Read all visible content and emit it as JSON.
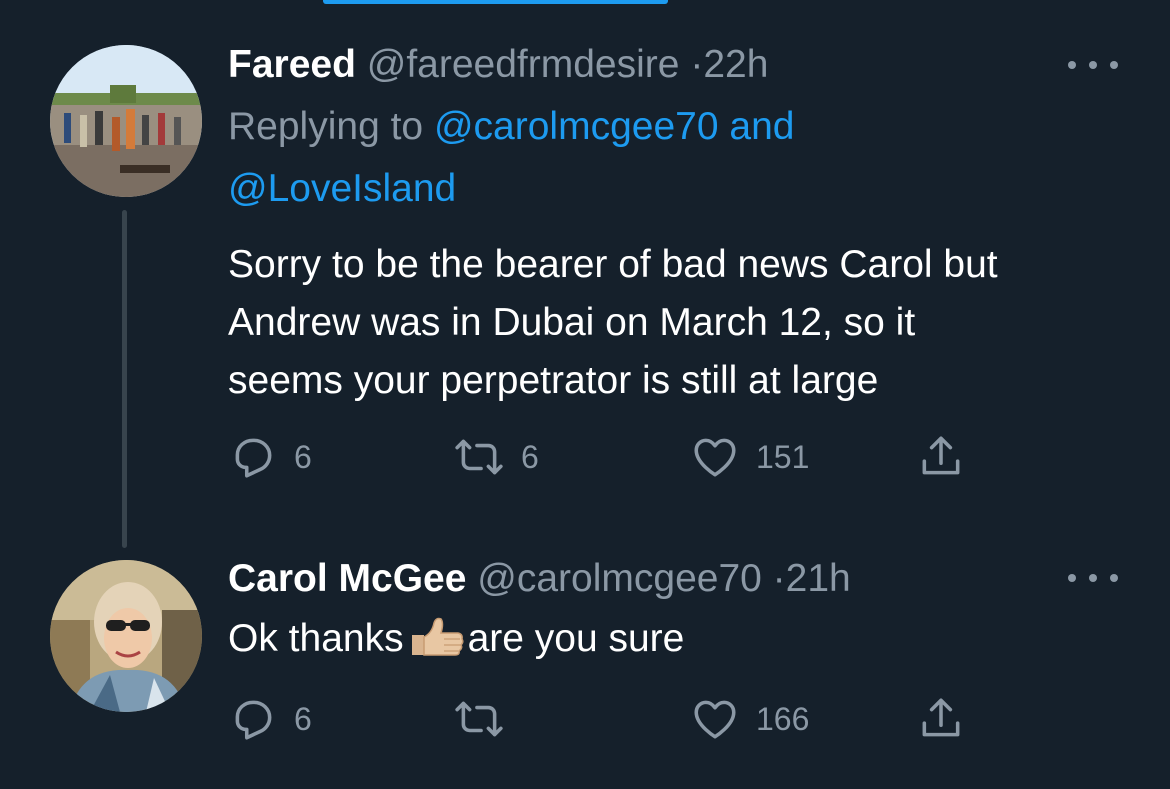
{
  "tweets": [
    {
      "name": "Fareed",
      "handle": "@fareedfrmdesire",
      "separator": "·",
      "time": "22h",
      "reply_prefix": "Replying to",
      "reply_user1": "@carolmcgee70",
      "reply_and": "and",
      "reply_user2": "@LoveIsland",
      "text_lines": [
        "Sorry to be the bearer of bad news Carol but",
        "Andrew was in Dubai on March 12, so it",
        "seems your perpetrator is still at large"
      ],
      "replies": "6",
      "retweets": "6",
      "likes": "151"
    },
    {
      "name": "Carol McGee",
      "handle": "@carolmcgee70",
      "separator": "·",
      "time": "21h",
      "text_before": "Ok thanks",
      "emoji": "thumbs-up",
      "text_after": "are you sure",
      "replies": "6",
      "retweets": "",
      "likes": "166"
    }
  ],
  "colors": {
    "background": "#15202b",
    "accent": "#1d9bf0",
    "muted": "#8b98a5",
    "thread_line": "#38444d"
  }
}
